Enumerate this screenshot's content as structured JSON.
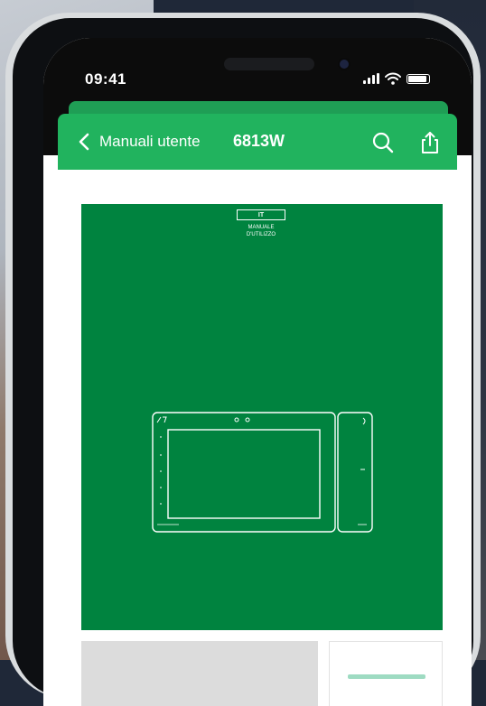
{
  "status_bar": {
    "time": "09:41"
  },
  "header": {
    "back_label": "Manuali utente",
    "title": "6813W",
    "search_icon": "search-icon",
    "share_icon": "share-icon"
  },
  "document": {
    "language_badge": "IT",
    "subtitle_line1": "MANUALE",
    "subtitle_line2": "D'UTILIZZO",
    "cover_color": "#00833f"
  },
  "colors": {
    "header": "#21b35e",
    "accent": "#00833f"
  }
}
